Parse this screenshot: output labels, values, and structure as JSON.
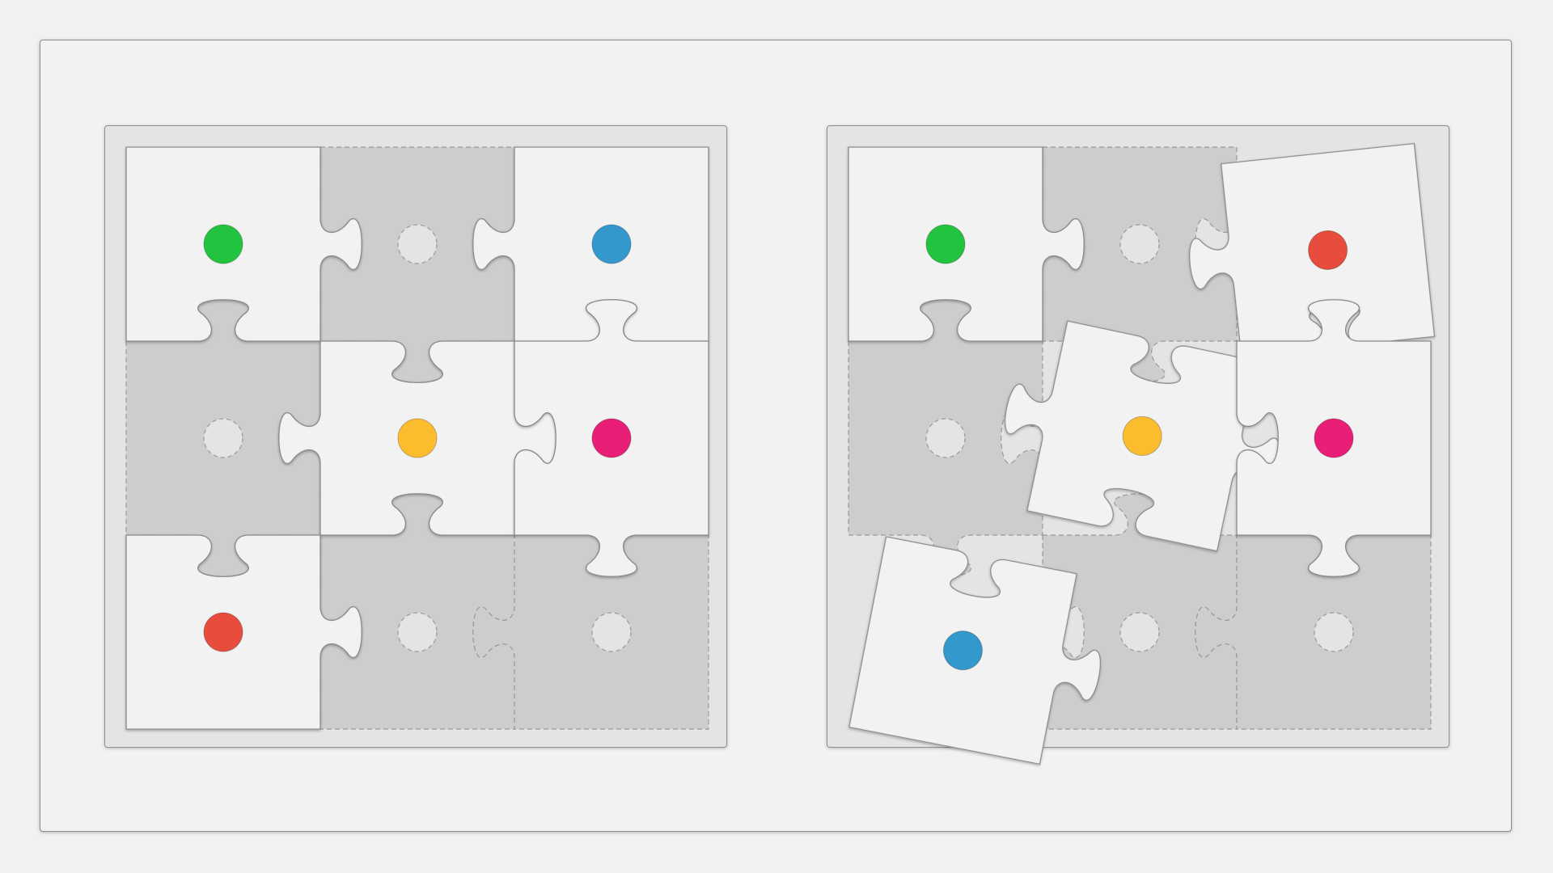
{
  "game": {
    "type": "jigsaw-spot-the-difference",
    "grid": {
      "rows": 3,
      "cols": 3
    },
    "colors": {
      "green": "#22c43f",
      "blue": "#3399cc",
      "yellow": "#fbbd2e",
      "pink": "#e91e77",
      "red": "#e74c3c",
      "piece_fill": "#f2f2f2",
      "empty_slot_fill": "#cdcdcd",
      "board_fill": "#e4e4e4"
    },
    "boards": [
      {
        "id": "left",
        "cells": [
          {
            "state": "piece",
            "marker": "green"
          },
          {
            "state": "empty"
          },
          {
            "state": "piece",
            "marker": "blue"
          },
          {
            "state": "empty"
          },
          {
            "state": "piece",
            "marker": "yellow"
          },
          {
            "state": "piece",
            "marker": "pink"
          },
          {
            "state": "piece",
            "marker": "red"
          },
          {
            "state": "empty"
          },
          {
            "state": "empty"
          }
        ]
      },
      {
        "id": "right",
        "cells": [
          {
            "state": "piece",
            "marker": "green"
          },
          {
            "state": "empty"
          },
          {
            "state": "piece",
            "marker": "red"
          },
          {
            "state": "empty"
          },
          {
            "state": "piece",
            "marker": "yellow"
          },
          {
            "state": "piece",
            "marker": "pink"
          },
          {
            "state": "piece",
            "marker": "blue"
          },
          {
            "state": "empty"
          },
          {
            "state": "empty"
          }
        ]
      }
    ]
  }
}
